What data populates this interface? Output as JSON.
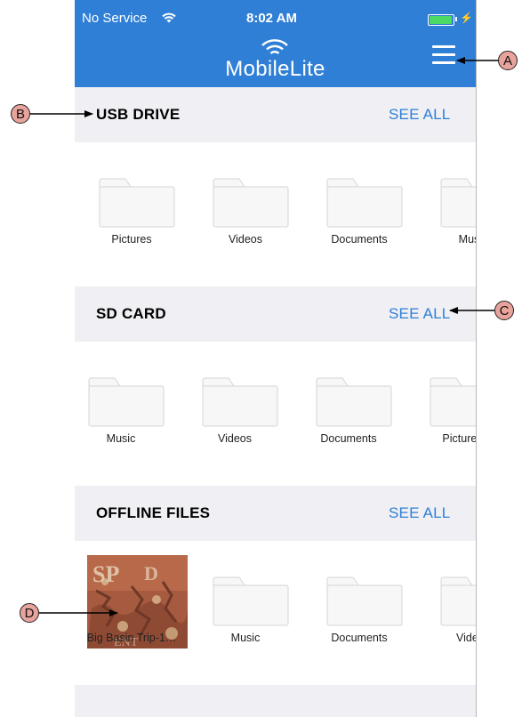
{
  "status_bar": {
    "carrier": "No Service",
    "time": "8:02 AM",
    "battery_level": 0.95
  },
  "app": {
    "title": "MobileLite"
  },
  "sections": [
    {
      "title": "USB DRIVE",
      "see_all": "SEE ALL",
      "items": [
        "Pictures",
        "Videos",
        "Documents",
        "Music"
      ]
    },
    {
      "title": "SD CARD",
      "see_all": "SEE ALL",
      "items": [
        "Music",
        "Videos",
        "Documents",
        "Pictures"
      ]
    },
    {
      "title": "OFFLINE FILES",
      "see_all": "SEE ALL",
      "items": [
        "Big Basin Trip-1…",
        "Music",
        "Documents",
        "Videos"
      ]
    }
  ],
  "callouts": {
    "a": "A",
    "b": "B",
    "c": "C",
    "d": "D"
  },
  "colors": {
    "accent": "#2f7fd6",
    "header_bg": "#efeff4",
    "callout_fill": "#e7a39c"
  }
}
